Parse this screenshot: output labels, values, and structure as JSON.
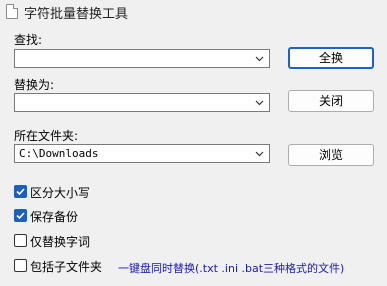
{
  "window": {
    "title": "字符批量替换工具",
    "icon": "document-icon"
  },
  "find": {
    "label": "查找:",
    "value": ""
  },
  "replace": {
    "label": "替换为:",
    "value": ""
  },
  "folder": {
    "label": "所在文件夹:",
    "value": "C:\\Downloads"
  },
  "buttons": {
    "replace_all": "全换",
    "close": "关闭",
    "browse": "浏览"
  },
  "options": [
    {
      "label": "区分大小写",
      "checked": true
    },
    {
      "label": "保存备份",
      "checked": true
    },
    {
      "label": "仅替换字词",
      "checked": false
    },
    {
      "label": "包括子文件夹",
      "checked": false
    }
  ],
  "note": "一键盘同时替换(.txt .ini .bat三种格式的文件)",
  "colors": {
    "accent": "#1b63c6",
    "checkbox": "#1f5fb8",
    "note": "#1a1ab0"
  }
}
